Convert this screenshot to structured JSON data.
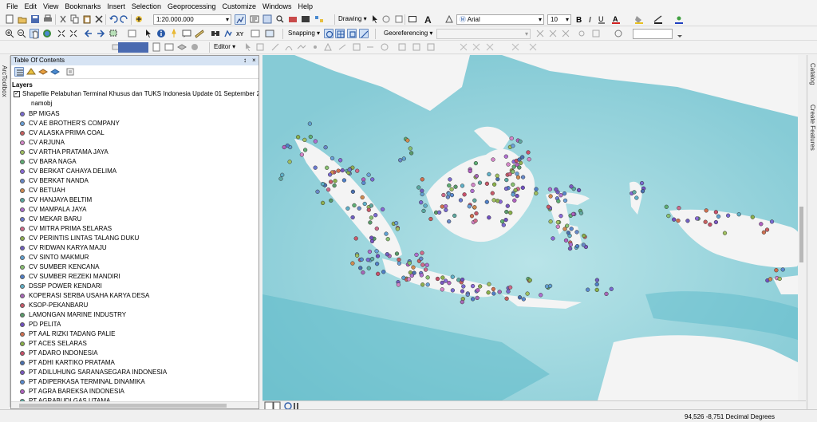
{
  "menu": [
    "File",
    "Edit",
    "View",
    "Bookmarks",
    "Insert",
    "Selection",
    "Geoprocessing",
    "Customize",
    "Windows",
    "Help"
  ],
  "toolbar": {
    "scale_value": "1:20.000.000",
    "drawing_label": "Drawing",
    "font_name": "Arial",
    "font_size": "10",
    "snapping_label": "Snapping",
    "georeferencing_label": "Georeferencing",
    "editor_label": "Editor"
  },
  "left_tab_label": "ArcToolbox",
  "toc": {
    "title": "Table Of Contents",
    "pin_glyph": "↕",
    "close_glyph": "×",
    "layers_label": "Layers",
    "layer_name": "Shapefile Pelabuhan Terminal Khusus dan TUKS Indonesia Update 01 September 2",
    "field_label": "namobj",
    "items": [
      {
        "label": "BP MIGAS",
        "color": "#7a6bd1"
      },
      {
        "label": "CV AE BROTHER'S COMPANY",
        "color": "#6aa0d8"
      },
      {
        "label": "CV ALASKA PRIMA COAL",
        "color": "#c86060"
      },
      {
        "label": "CV ARJUNA",
        "color": "#d486c8"
      },
      {
        "label": "CV ARTHA PRATAMA JAYA",
        "color": "#a0c060"
      },
      {
        "label": "CV BARA NAGA",
        "color": "#5fae74"
      },
      {
        "label": "CV BERKAT CAHAYA DELIMA",
        "color": "#8a6ad8"
      },
      {
        "label": "CV BERKAT NANDA",
        "color": "#6888c8"
      },
      {
        "label": "CV BETUAH",
        "color": "#d08a50"
      },
      {
        "label": "CV HANJAYA BELTIM",
        "color": "#5aa8a0"
      },
      {
        "label": "CV MAMPALA JAYA",
        "color": "#b070d0"
      },
      {
        "label": "CV MEKAR BARU",
        "color": "#6a7ad0"
      },
      {
        "label": "CV MITRA PRIMA SELARAS",
        "color": "#d06a8a"
      },
      {
        "label": "CV PERINTIS LINTAS TALANG DUKU",
        "color": "#90b050"
      },
      {
        "label": "CV RIDWAN KARYA MAJU",
        "color": "#7060c0"
      },
      {
        "label": "CV SINTO MAKMUR",
        "color": "#60a0d0"
      },
      {
        "label": "CV SUMBER KENCANA",
        "color": "#88c070"
      },
      {
        "label": "CV SUMBER REZEKI MANDIRI",
        "color": "#5080c8"
      },
      {
        "label": "DSSP POWER KENDARI",
        "color": "#60b0c8"
      },
      {
        "label": "KOPERASI SERBA USAHA KARYA DESA",
        "color": "#a868b8"
      },
      {
        "label": "KSOP-PEKANBARU",
        "color": "#c85a6a"
      },
      {
        "label": "LAMONGAN MARINE INDUSTRY",
        "color": "#5a9a6a"
      },
      {
        "label": "PD PELITA",
        "color": "#7050c0"
      },
      {
        "label": "PT AAL RIZKI TADANG PALIE",
        "color": "#d07050"
      },
      {
        "label": "PT ACES SELARAS",
        "color": "#8ab04a"
      },
      {
        "label": "PT ADARO INDONESIA",
        "color": "#c8506a"
      },
      {
        "label": "PT ADHI KARTIKO PRATAMA",
        "color": "#4a70b0"
      },
      {
        "label": "PT ADILUHUNG SARANASEGARA INDONESIA",
        "color": "#7a58c0"
      },
      {
        "label": "PT ADIPERKASA TERMINAL DINAMIKA",
        "color": "#5a8ad0"
      },
      {
        "label": "PT AGRA BAREKSA INDONESIA",
        "color": "#b060c0"
      },
      {
        "label": "PT AGRABUDI GAS UTAMA",
        "color": "#60a8a0"
      }
    ]
  },
  "right_tabs": [
    "Catalog",
    "Create Features"
  ],
  "colors": {
    "sea": "#9fd6de",
    "deep_sea": "#6cc0cf",
    "land": "#f4f4f4",
    "toc_title_bg": "#d6e3f3"
  },
  "status": {
    "coordinates": "94,526  -8,751 Decimal Degrees"
  }
}
